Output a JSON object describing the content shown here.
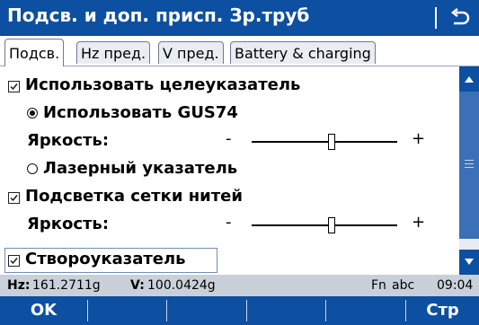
{
  "window": {
    "title": "Подсв. и доп. присп. Зр.труб"
  },
  "tabs": [
    {
      "label": "Подсв."
    },
    {
      "label": "Hz пред."
    },
    {
      "label": "V пред."
    },
    {
      "label": "Battery & charging"
    }
  ],
  "settings": {
    "use_guide": {
      "label": "Использовать целеуказатель",
      "checked": true
    },
    "use_gus74": {
      "label": "Использовать GUS74",
      "selected": true
    },
    "brightness1": {
      "label": "Яркость:",
      "min": "-",
      "max": "+",
      "level": 0.55
    },
    "laser": {
      "label": "Лазерный указатель",
      "selected": false
    },
    "reticle": {
      "label": "Подсветка сетки нитей",
      "checked": true
    },
    "brightness2": {
      "label": "Яркость:",
      "min": "-",
      "max": "+",
      "level": 0.55
    },
    "alignment": {
      "label": "Створоуказатель",
      "checked": true
    }
  },
  "status": {
    "hz_label": "Hz:",
    "hz_value": "161.2711g",
    "v_label": "V:",
    "v_value": "100.0424g",
    "fn": "Fn",
    "abc": "abc",
    "time": "09:04"
  },
  "softkeys": {
    "ok": "OK",
    "page": "Стр"
  },
  "colors": {
    "accent": "#0d4fa0",
    "status_bg": "#c9d0d9"
  }
}
